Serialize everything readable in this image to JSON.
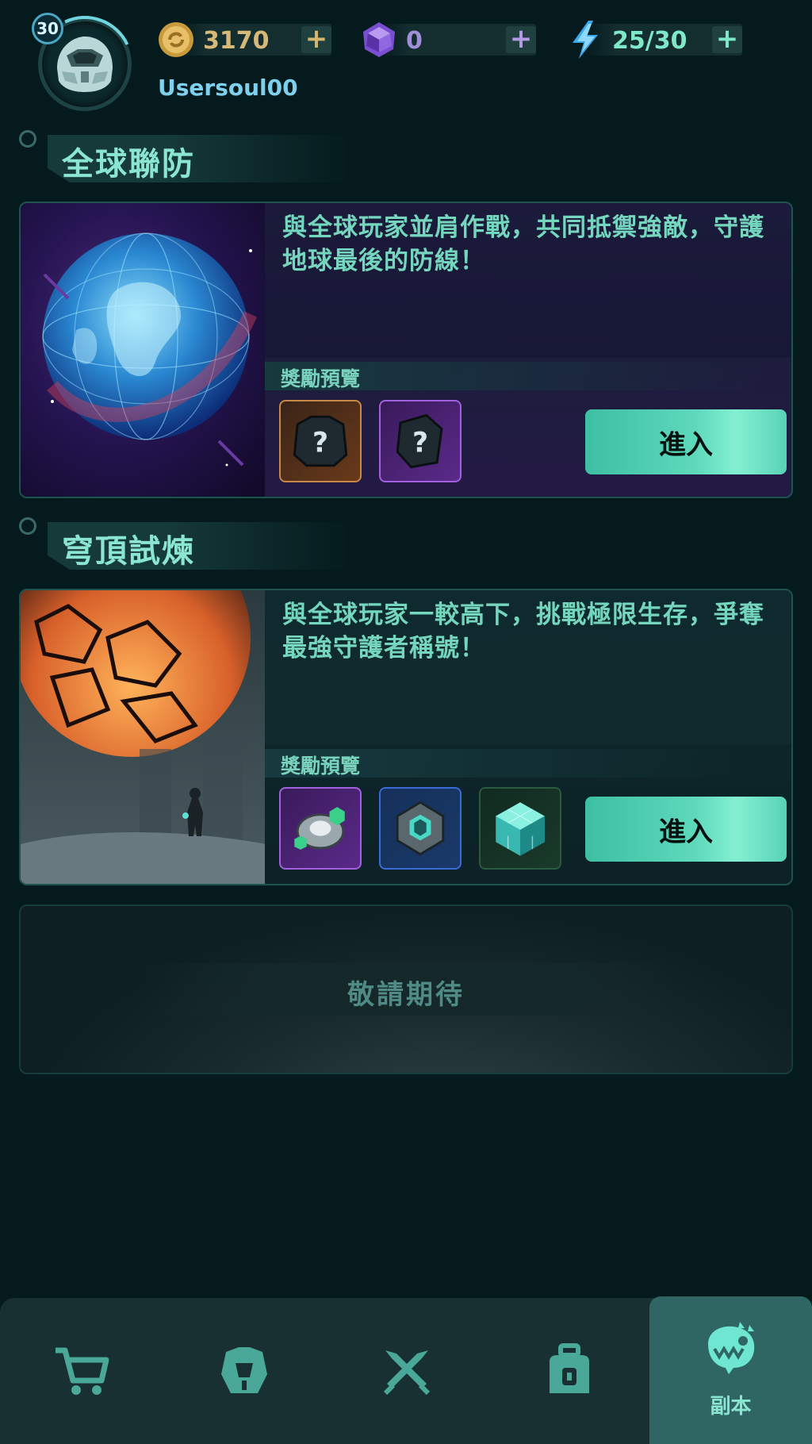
{
  "player": {
    "level": "30",
    "username": "Usersoul00"
  },
  "resources": {
    "gold": "3170",
    "gems": "0",
    "energy": "25/30",
    "add_symbol": "+"
  },
  "sections": [
    {
      "title": "全球聯防",
      "description": "與全球玩家並肩作戰，共同抵禦強敵，守護地球最後的防線！",
      "reward_label": "獎勵預覽",
      "rewards": [
        "mystery-armor-orange",
        "mystery-armor-purple"
      ],
      "enter_label": "進入"
    },
    {
      "title": "穹頂試煉",
      "description": "與全球玩家一較高下，挑戰極限生存，爭奪最強守護者稱號！",
      "reward_label": "獎勵預覽",
      "rewards": [
        "core-module-purple",
        "core-module-blue",
        "crystal-cube-green"
      ],
      "enter_label": "進入"
    }
  ],
  "coming_soon": "敬請期待",
  "nav": {
    "items": [
      {
        "icon": "cart-icon"
      },
      {
        "icon": "armor-icon"
      },
      {
        "icon": "crossed-swords-icon"
      },
      {
        "icon": "backpack-icon"
      },
      {
        "icon": "monster-icon",
        "label": "副本",
        "active": true
      }
    ]
  },
  "colors": {
    "background": "#051a1d",
    "accent": "#5ed9bc",
    "text": "#7fe3cd"
  }
}
